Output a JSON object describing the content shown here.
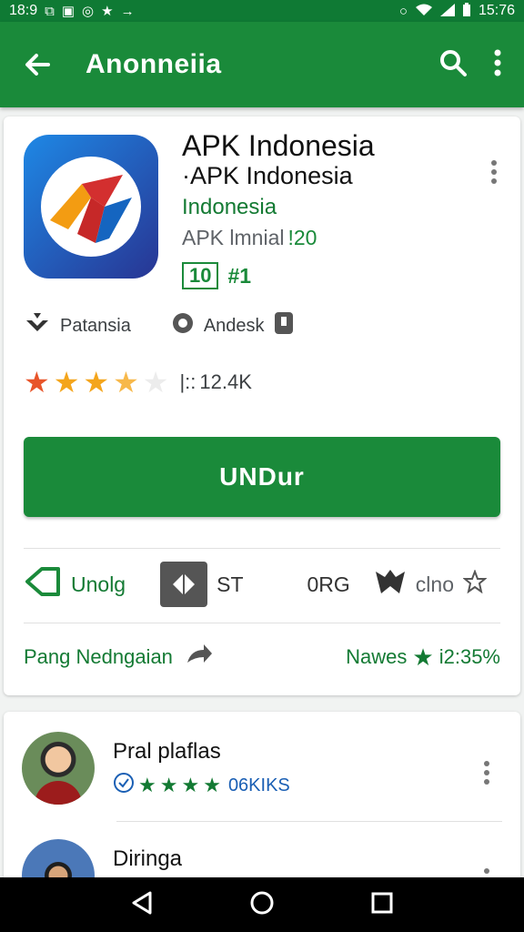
{
  "status_bar": {
    "time_left": "18:9",
    "time_right": "15:76",
    "icons": [
      "gallery-icon",
      "image-icon",
      "whatsapp-icon",
      "flash-icon",
      "arrow-icon",
      "alarm-icon",
      "wifi-icon",
      "signal-icon",
      "battery-icon"
    ]
  },
  "app_bar": {
    "title": "Anonneiia",
    "back_icon": "back-arrow-icon",
    "search_icon": "search-icon",
    "menu_icon": "more-vert-icon",
    "color": "#1a8a3a"
  },
  "app": {
    "name_line1": "APK Indonesia",
    "name_line2": "·APK Indonesia",
    "developer": "Indonesia",
    "install_label": "APK lmnial",
    "install_badge": "!20",
    "age_rating": "10",
    "age_extra": "#1",
    "category": "Patansia",
    "source": "Andesk"
  },
  "rating": {
    "stars": 4,
    "separator": "|::",
    "count": "12.4K"
  },
  "download_button": "UNDur",
  "actions": {
    "unolg": "Unolg",
    "st": "ST",
    "org": "0RG",
    "clno": "clno"
  },
  "links": {
    "left": "Pang Nedngaian",
    "right_label": "Nawes",
    "right_value": "i2:35%"
  },
  "reviews": [
    {
      "name": "Pral plaflas",
      "count": "06KIKS"
    },
    {
      "name": "Diringa"
    }
  ],
  "colors": {
    "primary": "#1a8a3a",
    "star": "#f4a51c",
    "star_red": "#e8552a"
  }
}
